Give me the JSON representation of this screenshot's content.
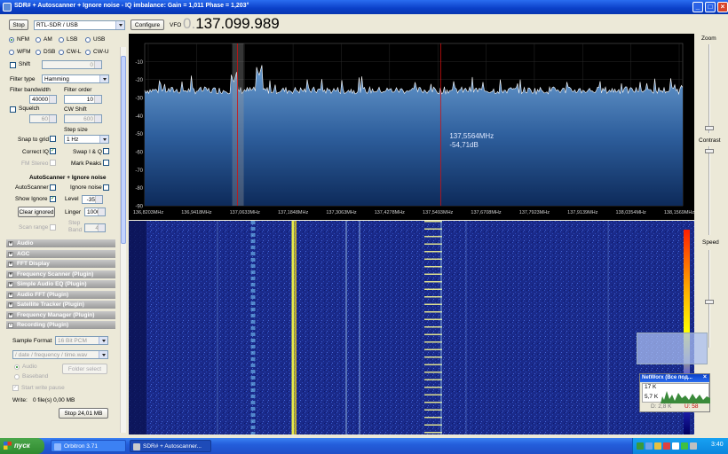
{
  "window": {
    "title": "SDR# + Autoscanner + Ignore noise - IQ imbalance: Gain = 1,011 Phase = 1,203°",
    "buttons": [
      "_",
      "□",
      "×"
    ]
  },
  "toolbar": {
    "stop_label": "Stop",
    "source_value": "RTL-SDR / USB",
    "configure_label": "Configure",
    "vfo_label": "VFO",
    "vfo_prefix": "0.",
    "vfo_value": "137.099.989"
  },
  "radio": {
    "modes_row1": [
      "NFM",
      "AM",
      "LSB",
      "USB"
    ],
    "modes_row2": [
      "WFM",
      "DSB",
      "CW-L",
      "CW-U"
    ],
    "selected_mode": "NFM",
    "shift_label": "Shift",
    "shift_value": "0",
    "filter_type_label": "Filter type",
    "filter_type_value": "Hamming",
    "filter_bandwidth_label": "Filter bandwidth",
    "filter_bandwidth_value": "40000",
    "filter_order_label": "Filter order",
    "filter_order_value": "10",
    "squelch_label": "Squelch",
    "squelch_value": "60",
    "cw_shift_label": "CW Shift",
    "cw_shift_value": "600",
    "step_size_label": "Step size",
    "step_size_value": "1 Hz",
    "snap_label": "Snap to grid",
    "correct_iq_label": "Correct IQ",
    "swap_iq_label": "Swap I & Q",
    "fm_stereo_label": "FM Stereo",
    "mark_peaks_label": "Mark Peaks"
  },
  "autoscanner": {
    "heading": "AutoScanner + Ignore noise",
    "autoscanner_label": "AutoScanner",
    "ignore_noise_label": "Ignore noise",
    "show_ignore_label": "Show Ignore",
    "level_label": "Level",
    "level_value": "-35",
    "clear_ignored_label": "Clear ignored",
    "linger_label": "Linger",
    "linger_value": "1000",
    "scan_range_label": "Scan range",
    "step_label": "Step",
    "band_label": "Band",
    "step_value": "4"
  },
  "sections": [
    {
      "label": "Audio",
      "sign": "+"
    },
    {
      "label": "AGC",
      "sign": "+"
    },
    {
      "label": "FFT Display",
      "sign": "+"
    },
    {
      "label": "Frequency Scanner (Plugin)",
      "sign": "+"
    },
    {
      "label": "Simple Audio EQ (Plugin)",
      "sign": "+"
    },
    {
      "label": "Audio FFT (Plugin)",
      "sign": "+"
    },
    {
      "label": "Satellite Tracker (Plugin)",
      "sign": "+"
    },
    {
      "label": "Frequency Manager (Plugin)",
      "sign": "+"
    },
    {
      "label": "Recording (Plugin)",
      "sign": "-"
    }
  ],
  "recording": {
    "sample_format_label": "Sample Format",
    "sample_format_value": "16 Bit PCM",
    "path_value": "/ date / frequency / time.wav",
    "audio_label": "Audio",
    "baseband_label": "Baseband",
    "folder_select_label": "Folder select",
    "start_on_pause_label": "Start write pause",
    "write_label": "Write:",
    "write_value": "0 file(s) 0,00 MB",
    "stop_button_label": "Stop 24,01 MB"
  },
  "chart_data": {
    "type": "line",
    "title": "",
    "xlabel": "",
    "ylabel": "",
    "ylim": [
      -90,
      0
    ],
    "yticks": [
      -10,
      -20,
      -30,
      -40,
      -50,
      -60,
      -70,
      -80,
      -90
    ],
    "xticks": [
      "136,8203MHz",
      "136,9418MHz",
      "137,0633MHz",
      "137,1848MHz",
      "137,3063MHz",
      "137,4278MHz",
      "137,5493MHz",
      "137,6708MHz",
      "137,7923MHz",
      "137,9139MHz",
      "138,0354MHz",
      "138,1569MHz"
    ],
    "noise_floor_db": -26,
    "peaks": [
      {
        "freq_mhz": 137.099,
        "db": -18
      },
      {
        "freq_mhz": 137.035,
        "db": -22
      }
    ],
    "cursor": {
      "freq_text": "137,5564MHz",
      "level_text": "-54,71dB"
    }
  },
  "right_panel": {
    "zoom_label": "Zoom",
    "contrast_label": "Contrast",
    "speed_label": "Speed"
  },
  "networx": {
    "title": "NetWorx (Все под...",
    "top_value": "17 K",
    "mid_value": "5,7 K",
    "down_label": "D: 2,8 K",
    "up_label": "U: 58"
  },
  "taskbar": {
    "start_label": "пуск",
    "tasks": [
      "Orbitron 3.71",
      "SDR# + Autoscanner..."
    ],
    "clock": "3:40"
  }
}
